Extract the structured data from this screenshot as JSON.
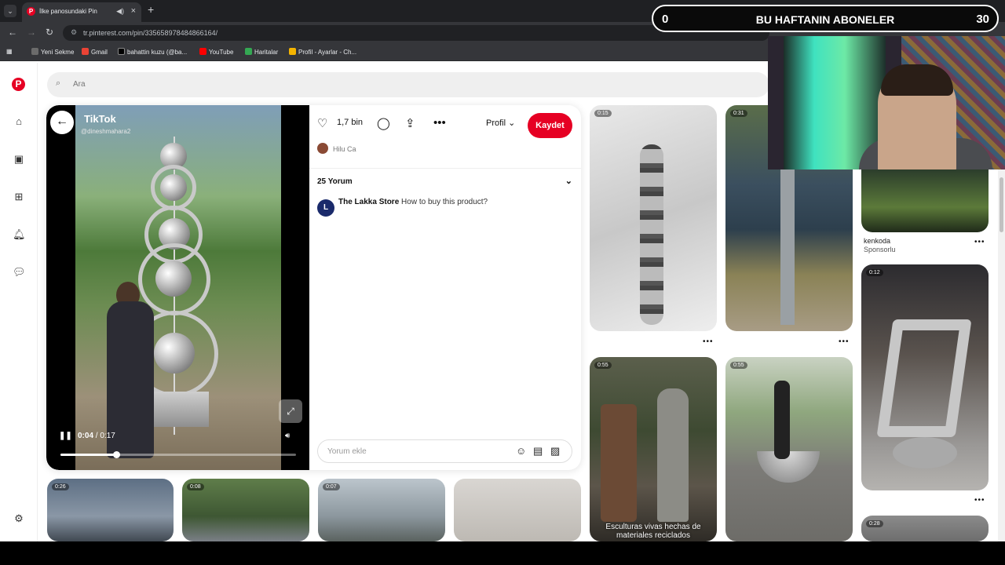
{
  "browser": {
    "tab_title": "İlke panosundaki Pin",
    "url": "tr.pinterest.com/pin/335658978484866164/",
    "bookmarks": [
      "Yeni Sekme",
      "Gmail",
      "bahattin kuzu (@ba...",
      "YouTube",
      "Haritalar",
      "Profil - Ayarlar - Ch..."
    ]
  },
  "overlay": {
    "left_count": "0",
    "title": "BU HAFTANIN ABONELER",
    "right_count": "30"
  },
  "search": {
    "placeholder": "Ara"
  },
  "pin": {
    "source": "TikTok",
    "handle": "@dineshmahara2",
    "time_current": "0:04",
    "time_total": "0:17",
    "progress": 0.235,
    "likes": "1,7 bin",
    "profile_label": "Profil",
    "save_label": "Kaydet",
    "author": "Hilu Ca",
    "comments_count_label": "25 Yorum",
    "comment_author": "The Lakka Store",
    "comment_text": "How to buy this product?",
    "comment_placeholder": "Yorum ekle"
  },
  "grid": {
    "pins": [
      {
        "duration": "0:15"
      },
      {
        "duration": "0:31"
      },
      {
        "duration": "0:55"
      },
      {
        "duration": "0:55",
        "caption": "Esculturas vivas hechas de materiales reciclados"
      },
      {
        "duration": "0:12"
      },
      {
        "duration": "0:26"
      },
      {
        "duration": "0:08"
      },
      {
        "duration": "0:07"
      },
      {
        "duration": "0:28"
      }
    ],
    "sponsor_name": "kenkoda",
    "sponsor_label": "Sponsorlu"
  },
  "colors": {
    "pinterest_red": "#e60023",
    "chrome_dark": "#35363a"
  }
}
